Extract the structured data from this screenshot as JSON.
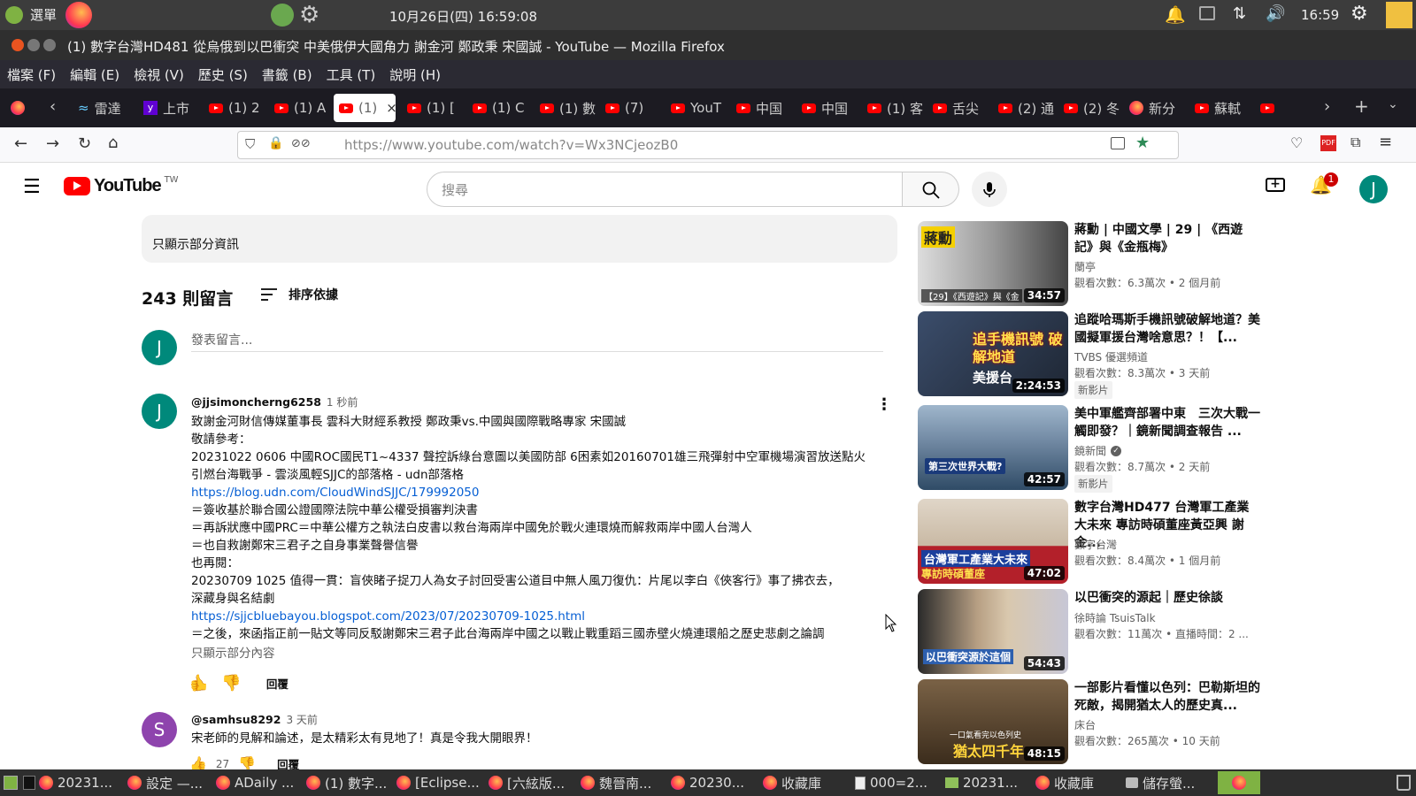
{
  "system": {
    "menu_label": "選單",
    "datetime": "10月26日(四) 16:59:08",
    "clock": "16:59"
  },
  "window": {
    "title": "(1) 數字台灣HD481 從烏俄到以巴衝突 中美俄伊大國角力 謝金河 鄭政秉 宋國誠 - YouTube — Mozilla Firefox"
  },
  "menu": {
    "items": [
      "檔案 (F)",
      "編輯 (E)",
      "檢視 (V)",
      "歷史 (S)",
      "書籤 (B)",
      "工具 (T)",
      "說明 (H)"
    ]
  },
  "tabs": [
    {
      "label": "雷達"
    },
    {
      "label": "上市"
    },
    {
      "label": "(1) 2"
    },
    {
      "label": "(1) A"
    },
    {
      "label": "(1)"
    },
    {
      "label": "(1) ["
    },
    {
      "label": "(1) C"
    },
    {
      "label": "(1) 數"
    },
    {
      "label": "(7)"
    },
    {
      "label": "YouT"
    },
    {
      "label": "中国"
    },
    {
      "label": "中国"
    },
    {
      "label": "(1) 客"
    },
    {
      "label": "舌尖"
    },
    {
      "label": "(2) 通"
    },
    {
      "label": "(2) 冬"
    },
    {
      "label": "新分"
    },
    {
      "label": "蘇軾"
    }
  ],
  "url": "https://www.youtube.com/watch?v=Wx3NCjeozB0",
  "yt": {
    "logo": "YouTube",
    "region": "TW",
    "search_placeholder": "搜尋",
    "notif_count": "1",
    "user_initial": "J"
  },
  "description": {
    "collapse_label": "只顯示部分資訊"
  },
  "comments": {
    "count_label": "243 則留言",
    "sort_label": "排序依據",
    "add_placeholder": "發表留言...",
    "items": [
      {
        "initial": "J",
        "author": "@jjsimoncherng6258",
        "time": "1 秒前",
        "lines": [
          "致謝金河財信傳媒董事長 雲科大財經系教授 鄭政秉vs.中國與國際戰略專家 宋國誠",
          "敬請參考：",
          "20231022 0606 中國ROC國民T1~4337 聲控訴綠台意圖以美國防部 6困素如20160701雄三飛彈射中空軍機場演習放送點火",
          "引燃台海戰爭 - 雲淡風輕SJJC的部落格 - udn部落格",
          "https://blog.udn.com/CloudWindSJJC/179992050",
          "＝簽收基於聯合國公證國際法院中華公權受損審判決書",
          "＝再訴狀應中國PRC＝中華公權方之執法白皮書以救台海兩岸中國免於戰火連環燒而解救兩岸中國人台灣人",
          "＝也自救謝鄭宋三君子之自身事業聲譽信譽",
          "也再閱：",
          "20230709 1025 值得一貫：盲俠睹子捉刀人為女子討回受害公道目中無人風刀復仇：片尾以李白《俠客行》事了拂衣去，",
          "深藏身與名結劇",
          "https://sjjcbluebayou.blogspot.com/2023/07/20230709-1025.html",
          "＝之後，來函指正前一貼文等同反駁謝鄭宋三君子此台海兩岸中國之以戰止戰重蹈三國赤壁火燒連環船之歷史悲劇之論調"
        ],
        "show_less": "只顯示部分內容",
        "likes": "",
        "reply_label": "回覆"
      },
      {
        "initial": "S",
        "author": "@samhsu8292",
        "time": "3 天前",
        "lines": [
          "宋老師的見解和論述，是太精彩太有見地了！真是令我大開眼界！"
        ],
        "likes": "27",
        "reply_label": "回覆"
      }
    ]
  },
  "related": [
    {
      "title": "蔣勳 | 中國文學 | 29 | 《西遊記》與《金瓶梅》",
      "channel": "蘭亭",
      "meta": "觀看次數：6.3萬次 • 2 個月前",
      "duration": "34:57",
      "thumb_text": "蔣勳",
      "thumb_sub": "【29】《西遊記》與《金",
      "badge": "",
      "color": "#6a6a6a"
    },
    {
      "title": "追蹤哈瑪斯手機訊號破解地道？美國擬軍援台灣啥意思？！【...",
      "channel": "TVBS 優選頻道",
      "meta": "觀看次數：8.3萬次 • 3 天前",
      "duration": "2:24:53",
      "thumb_text": "追手機訊號 破解地道",
      "thumb_sub": "美援台",
      "badge": "新影片",
      "color": "#2a3a55"
    },
    {
      "title": "美中軍艦齊部署中東　三次大戰一觸即發？｜鏡新聞調查報告 ...",
      "channel": "鏡新聞",
      "meta": "觀看次數：8.7萬次 • 2 天前",
      "duration": "42:57",
      "thumb_text": "第三次世界大戰?",
      "thumb_sub": "",
      "badge": "新影片",
      "color": "#4f6a86"
    },
    {
      "title": "數字台灣HD477 台灣軍工產業大未來 專訪時碩董座黃亞興 謝金...",
      "channel": "數字台灣",
      "meta": "觀看次數：8.4萬次 • 1 個月前",
      "duration": "47:02",
      "thumb_text": "台灣軍工產業大未來",
      "thumb_sub": "專訪時碩董座",
      "badge": "",
      "color": "#b3202a"
    },
    {
      "title": "以巴衝突的源起｜歷史徐談",
      "channel": "徐時論 TsuisTalk",
      "meta": "觀看次數：11萬次 • 直播時間：2 ...",
      "duration": "54:43",
      "thumb_text": "以巴衝突源於這個",
      "thumb_sub": "",
      "badge": "",
      "color": "#7a6652"
    },
    {
      "title": "一部影片看懂以色列：巴勒斯坦的死敵，揭開猶太人的歷史真...",
      "channel": "床台",
      "meta": "觀看次數：265萬次 • 10 天前",
      "duration": "48:15",
      "thumb_text": "猶太四千年",
      "thumb_sub": "一口氣看完以色列史",
      "badge": "",
      "color": "#5a4632"
    }
  ],
  "taskbar": [
    {
      "label": "20231..."
    },
    {
      "label": "設定 —..."
    },
    {
      "label": "ADaily ..."
    },
    {
      "label": "(1) 數字..."
    },
    {
      "label": "[Eclipse..."
    },
    {
      "label": "[六絃版..."
    },
    {
      "label": "魏晉南..."
    },
    {
      "label": "20230..."
    },
    {
      "label": "收藏庫"
    },
    {
      "label": "000=2..."
    },
    {
      "label": "20231..."
    },
    {
      "label": "收藏庫"
    },
    {
      "label": "儲存螢..."
    }
  ]
}
